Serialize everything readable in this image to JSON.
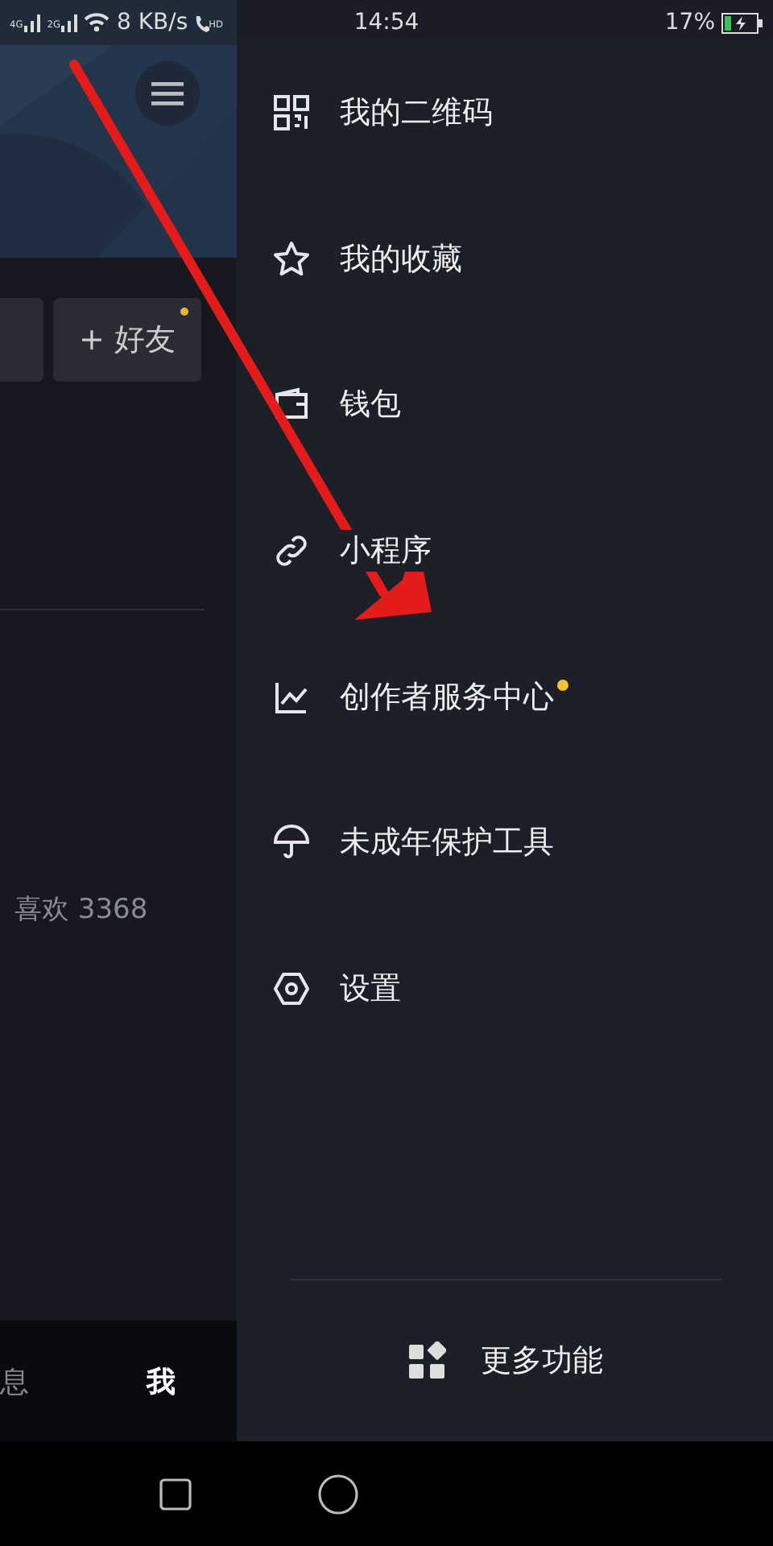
{
  "status_bar": {
    "sim_1": "4G",
    "sim_2": "2G",
    "speed": "8 KB/s",
    "call": "HD",
    "time": "14:54",
    "battery": "17%"
  },
  "profile": {
    "friend_button": {
      "label": "+ 好友",
      "badge": true
    },
    "likes": "喜欢 3368"
  },
  "tab_bar": [
    {
      "label": "息",
      "selected": false
    },
    {
      "label": "我",
      "selected": true
    }
  ],
  "drawer": {
    "items": [
      {
        "kind": "qrcode",
        "label": "我的二维码",
        "badge": false
      },
      {
        "kind": "star",
        "label": "我的收藏",
        "badge": false
      },
      {
        "kind": "wallet",
        "label": "钱包",
        "badge": false
      },
      {
        "kind": "link",
        "label": "小程序",
        "badge": false
      },
      {
        "kind": "chart",
        "label": "创作者服务中心",
        "badge": true
      },
      {
        "kind": "umbrella",
        "label": "未成年保护工具",
        "badge": false
      },
      {
        "kind": "settings",
        "label": "设置",
        "badge": false
      }
    ],
    "more": "更多功能"
  }
}
